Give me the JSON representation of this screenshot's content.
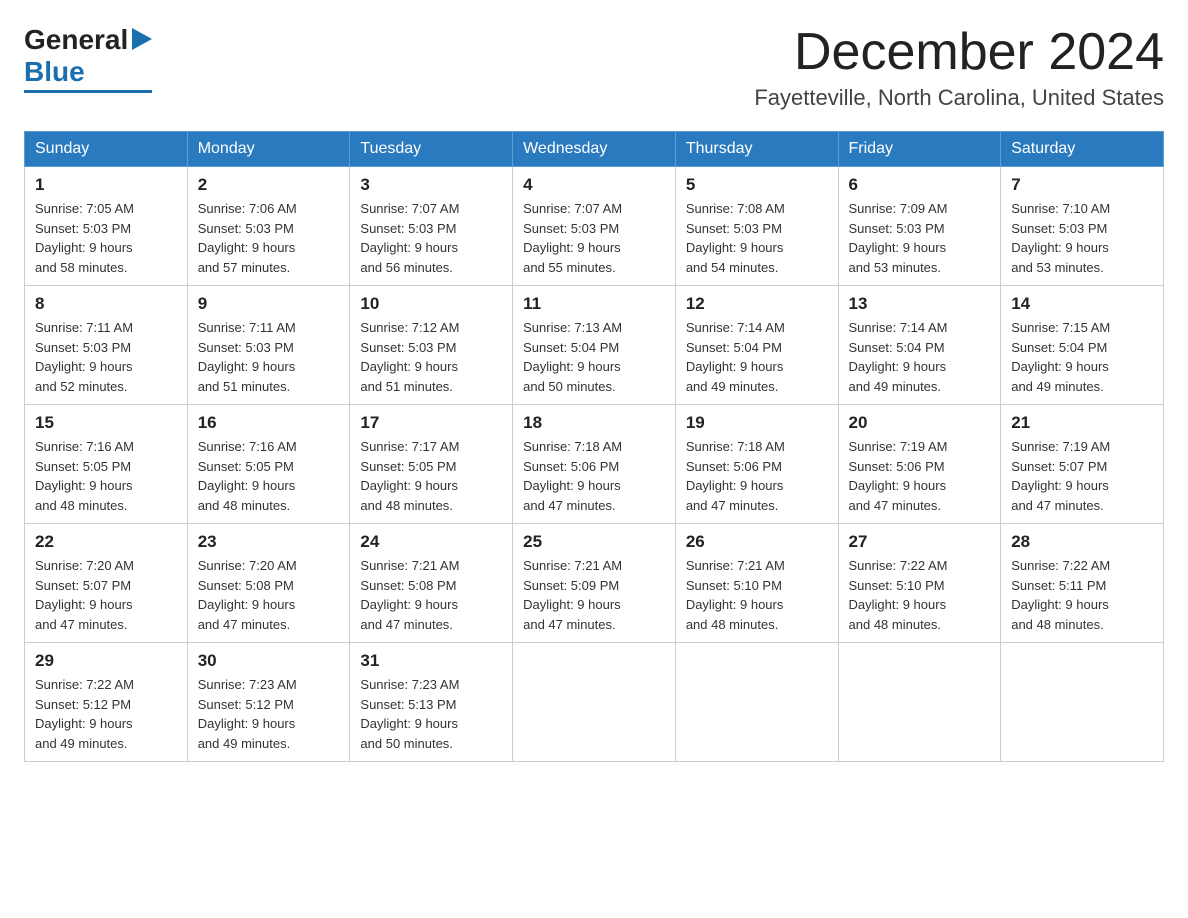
{
  "logo": {
    "general": "General",
    "blue": "Blue",
    "triangle_char": "▶"
  },
  "title": {
    "month_year": "December 2024",
    "location": "Fayetteville, North Carolina, United States"
  },
  "days_header": [
    "Sunday",
    "Monday",
    "Tuesday",
    "Wednesday",
    "Thursday",
    "Friday",
    "Saturday"
  ],
  "weeks": [
    [
      {
        "day": "1",
        "sunrise": "7:05 AM",
        "sunset": "5:03 PM",
        "daylight": "9 hours and 58 minutes."
      },
      {
        "day": "2",
        "sunrise": "7:06 AM",
        "sunset": "5:03 PM",
        "daylight": "9 hours and 57 minutes."
      },
      {
        "day": "3",
        "sunrise": "7:07 AM",
        "sunset": "5:03 PM",
        "daylight": "9 hours and 56 minutes."
      },
      {
        "day": "4",
        "sunrise": "7:07 AM",
        "sunset": "5:03 PM",
        "daylight": "9 hours and 55 minutes."
      },
      {
        "day": "5",
        "sunrise": "7:08 AM",
        "sunset": "5:03 PM",
        "daylight": "9 hours and 54 minutes."
      },
      {
        "day": "6",
        "sunrise": "7:09 AM",
        "sunset": "5:03 PM",
        "daylight": "9 hours and 53 minutes."
      },
      {
        "day": "7",
        "sunrise": "7:10 AM",
        "sunset": "5:03 PM",
        "daylight": "9 hours and 53 minutes."
      }
    ],
    [
      {
        "day": "8",
        "sunrise": "7:11 AM",
        "sunset": "5:03 PM",
        "daylight": "9 hours and 52 minutes."
      },
      {
        "day": "9",
        "sunrise": "7:11 AM",
        "sunset": "5:03 PM",
        "daylight": "9 hours and 51 minutes."
      },
      {
        "day": "10",
        "sunrise": "7:12 AM",
        "sunset": "5:03 PM",
        "daylight": "9 hours and 51 minutes."
      },
      {
        "day": "11",
        "sunrise": "7:13 AM",
        "sunset": "5:04 PM",
        "daylight": "9 hours and 50 minutes."
      },
      {
        "day": "12",
        "sunrise": "7:14 AM",
        "sunset": "5:04 PM",
        "daylight": "9 hours and 49 minutes."
      },
      {
        "day": "13",
        "sunrise": "7:14 AM",
        "sunset": "5:04 PM",
        "daylight": "9 hours and 49 minutes."
      },
      {
        "day": "14",
        "sunrise": "7:15 AM",
        "sunset": "5:04 PM",
        "daylight": "9 hours and 49 minutes."
      }
    ],
    [
      {
        "day": "15",
        "sunrise": "7:16 AM",
        "sunset": "5:05 PM",
        "daylight": "9 hours and 48 minutes."
      },
      {
        "day": "16",
        "sunrise": "7:16 AM",
        "sunset": "5:05 PM",
        "daylight": "9 hours and 48 minutes."
      },
      {
        "day": "17",
        "sunrise": "7:17 AM",
        "sunset": "5:05 PM",
        "daylight": "9 hours and 48 minutes."
      },
      {
        "day": "18",
        "sunrise": "7:18 AM",
        "sunset": "5:06 PM",
        "daylight": "9 hours and 47 minutes."
      },
      {
        "day": "19",
        "sunrise": "7:18 AM",
        "sunset": "5:06 PM",
        "daylight": "9 hours and 47 minutes."
      },
      {
        "day": "20",
        "sunrise": "7:19 AM",
        "sunset": "5:06 PM",
        "daylight": "9 hours and 47 minutes."
      },
      {
        "day": "21",
        "sunrise": "7:19 AM",
        "sunset": "5:07 PM",
        "daylight": "9 hours and 47 minutes."
      }
    ],
    [
      {
        "day": "22",
        "sunrise": "7:20 AM",
        "sunset": "5:07 PM",
        "daylight": "9 hours and 47 minutes."
      },
      {
        "day": "23",
        "sunrise": "7:20 AM",
        "sunset": "5:08 PM",
        "daylight": "9 hours and 47 minutes."
      },
      {
        "day": "24",
        "sunrise": "7:21 AM",
        "sunset": "5:08 PM",
        "daylight": "9 hours and 47 minutes."
      },
      {
        "day": "25",
        "sunrise": "7:21 AM",
        "sunset": "5:09 PM",
        "daylight": "9 hours and 47 minutes."
      },
      {
        "day": "26",
        "sunrise": "7:21 AM",
        "sunset": "5:10 PM",
        "daylight": "9 hours and 48 minutes."
      },
      {
        "day": "27",
        "sunrise": "7:22 AM",
        "sunset": "5:10 PM",
        "daylight": "9 hours and 48 minutes."
      },
      {
        "day": "28",
        "sunrise": "7:22 AM",
        "sunset": "5:11 PM",
        "daylight": "9 hours and 48 minutes."
      }
    ],
    [
      {
        "day": "29",
        "sunrise": "7:22 AM",
        "sunset": "5:12 PM",
        "daylight": "9 hours and 49 minutes."
      },
      {
        "day": "30",
        "sunrise": "7:23 AM",
        "sunset": "5:12 PM",
        "daylight": "9 hours and 49 minutes."
      },
      {
        "day": "31",
        "sunrise": "7:23 AM",
        "sunset": "5:13 PM",
        "daylight": "9 hours and 50 minutes."
      },
      null,
      null,
      null,
      null
    ]
  ],
  "labels": {
    "sunrise": "Sunrise: ",
    "sunset": "Sunset: ",
    "daylight": "Daylight: "
  },
  "colors": {
    "header_bg": "#2a7abf",
    "header_text": "#ffffff",
    "border": "#aaa",
    "row_border": "#2a7abf",
    "logo_blue": "#1a6faf"
  }
}
